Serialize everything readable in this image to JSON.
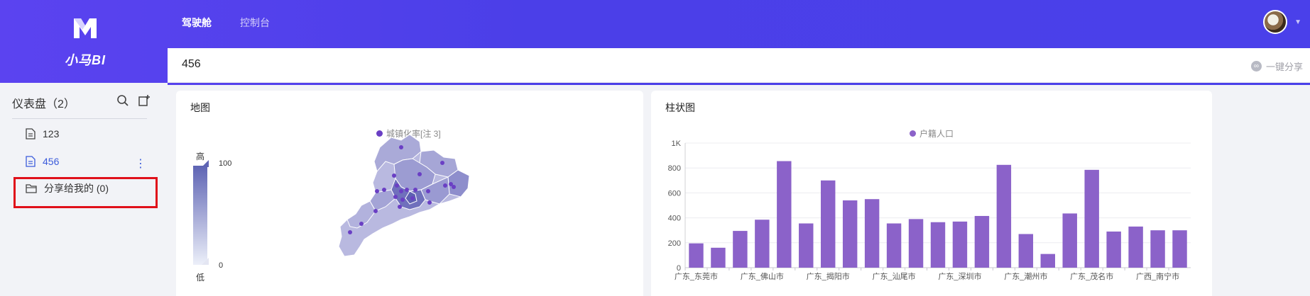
{
  "brand": {
    "name": "小马BI"
  },
  "topnav": [
    {
      "label": "驾驶舱",
      "active": true
    },
    {
      "label": "控制台",
      "active": false
    }
  ],
  "sidebar": {
    "title": "仪表盘（2）",
    "items": [
      {
        "label": "123",
        "active": false,
        "icon": "document-icon"
      },
      {
        "label": "456",
        "active": true,
        "icon": "document-icon"
      },
      {
        "label": "分享给我的 (0)",
        "active": false,
        "icon": "folder-icon"
      }
    ]
  },
  "dashboard": {
    "title": "456",
    "share_label": "一键分享"
  },
  "map_card": {
    "title": "地图",
    "legend": "城镇化率[注 3]",
    "visual_map": {
      "high_label": "高",
      "low_label": "低",
      "max": "100",
      "min": "0"
    },
    "colors": {
      "point": "#6a3fc4",
      "region_light": "#b9b9e0",
      "region_dark": "#7373be"
    }
  },
  "bar_card": {
    "title": "柱状图",
    "legend": "户籍人口",
    "colors": {
      "bar": "#8b62c9"
    }
  },
  "chart_data": {
    "type": "bar",
    "legend": "户籍人口",
    "categories": [
      "广东_东莞市",
      "",
      "",
      "广东_佛山市",
      "",
      "",
      "广东_揭阳市",
      "",
      "",
      "广东_汕尾市",
      "",
      "",
      "广东_深圳市",
      "",
      "",
      "广东_潮州市",
      "",
      "",
      "广东_茂名市",
      "",
      "",
      "广西_南宁市",
      ""
    ],
    "category_count": 23,
    "values": [
      195,
      160,
      295,
      385,
      855,
      355,
      700,
      540,
      550,
      355,
      390,
      365,
      370,
      415,
      825,
      270,
      110,
      435,
      785,
      290,
      330,
      300,
      300
    ],
    "y_ticks": [
      "0",
      "200",
      "400",
      "600",
      "800",
      "1K"
    ],
    "ylim": [
      0,
      1000
    ],
    "grid": true,
    "legend_position": "top-center"
  }
}
